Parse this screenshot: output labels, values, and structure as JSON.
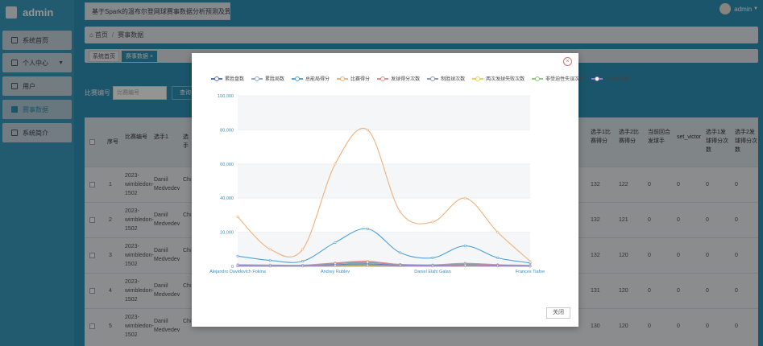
{
  "brand": {
    "name": "admin"
  },
  "user": {
    "name": "admin"
  },
  "header": {
    "title": "基于Spark的温布尔登网球赛事数据分析预测及算法实现"
  },
  "sidebar": {
    "items": [
      {
        "label": "系统首页",
        "icon": "home-icon"
      },
      {
        "label": "个人中心",
        "icon": "user-icon"
      },
      {
        "label": "用户",
        "icon": "grid-icon"
      },
      {
        "label": "赛事数据",
        "icon": "grid-icon"
      },
      {
        "label": "系统简介",
        "icon": "book-icon"
      }
    ]
  },
  "breadcrumb": {
    "home": "首页",
    "current": "赛事数据"
  },
  "tags": [
    {
      "label": "系统首页"
    },
    {
      "label": "赛事数据 ×"
    }
  ],
  "search": {
    "label": "比赛编号",
    "placeholder": "比赛编号",
    "button": "查询"
  },
  "table": {
    "headers": [
      "序号",
      "比赛编号",
      "选手1",
      "选手",
      "选手1比赛得分",
      "选手2比赛得分",
      "当前回合发球手",
      "set_victor",
      "选手1发球得分次数",
      "选手2发球得分次数"
    ],
    "rows": [
      {
        "index": "1",
        "match_id": "2023-wimbledon-1502",
        "player1": "Daniil Medvedev",
        "p2": "Chris",
        "p1_score": "132",
        "p2_score": "122",
        "server": "0",
        "victor": "0",
        "p1_serve": "0",
        "p2_serve": "0"
      },
      {
        "index": "2",
        "match_id": "2023-wimbledon-1502",
        "player1": "Daniil Medvedev",
        "p2": "Chris",
        "p1_score": "132",
        "p2_score": "121",
        "server": "0",
        "victor": "0",
        "p1_serve": "0",
        "p2_serve": "0"
      },
      {
        "index": "3",
        "match_id": "2023-wimbledon-1502",
        "player1": "Daniil Medvedev",
        "p2": "Chris",
        "p1_score": "132",
        "p2_score": "120",
        "server": "0",
        "victor": "0",
        "p1_serve": "0",
        "p2_serve": "0"
      },
      {
        "index": "4",
        "match_id": "2023-wimbledon-1502",
        "player1": "Daniil Medvedev",
        "p2": "Chris",
        "p1_score": "131",
        "p2_score": "120",
        "server": "0",
        "victor": "0",
        "p1_serve": "0",
        "p2_serve": "0"
      },
      {
        "index": "5",
        "match_id": "2023-wimbledon-1502",
        "player1": "Daniil Medvedev",
        "p2": "Chris",
        "p1_score": "130",
        "p2_score": "120",
        "server": "0",
        "victor": "0",
        "p1_serve": "0",
        "p2_serve": "0"
      }
    ]
  },
  "modal": {
    "close_label": "关闭"
  },
  "colors": {
    "accent": "#2f93b8"
  },
  "chart_data": {
    "type": "line",
    "categories": [
      "Alejandro Davidovich Fokina",
      "",
      "",
      "Andrey Rublev",
      "",
      "",
      "Daniel Elahi Galan",
      "",
      "",
      "Frances Tiafoe"
    ],
    "category_labels": [
      "Alejandro Davidovich Fokina",
      "Andrey Rublev",
      "Daniel Elahi Galan",
      "Frances Tiafoe"
    ],
    "ylim": [
      0,
      100000
    ],
    "yticks": [
      "0",
      "20,000",
      "40,000",
      "60,000",
      "80,000",
      "100,000"
    ],
    "grid": true,
    "legend_position": "top",
    "series": [
      {
        "name": "累胜盘数",
        "color": "#5470c6",
        "values": [
          300,
          200,
          200,
          1000,
          1500,
          500,
          300,
          900,
          400,
          200
        ]
      },
      {
        "name": "累胜局数",
        "color": "#91a7c7",
        "values": [
          1000,
          800,
          700,
          2000,
          2500,
          1200,
          900,
          1800,
          1000,
          600
        ]
      },
      {
        "name": "总能局得分",
        "color": "#4fa3d8",
        "values": [
          6000,
          3500,
          3000,
          14000,
          22000,
          8000,
          5000,
          12000,
          5000,
          2000
        ]
      },
      {
        "name": "比赛得分",
        "color": "#f3b07a",
        "values": [
          29000,
          10000,
          10000,
          60000,
          80000,
          32000,
          26000,
          40000,
          20000,
          3000
        ]
      },
      {
        "name": "发球得分次数",
        "color": "#e58b8b",
        "values": [
          500,
          300,
          300,
          2000,
          3000,
          1000,
          600,
          1600,
          800,
          300
        ]
      },
      {
        "name": "制胜球次数",
        "color": "#8a9bb0",
        "values": [
          400,
          300,
          300,
          1500,
          2200,
          800,
          500,
          1200,
          600,
          200
        ]
      },
      {
        "name": "两次发球失败次数",
        "color": "#e8d35a",
        "values": [
          100,
          80,
          80,
          300,
          400,
          200,
          100,
          250,
          120,
          60
        ]
      },
      {
        "name": "非受迫性失误次数",
        "color": "#8fc97a",
        "values": [
          300,
          200,
          200,
          700,
          900,
          400,
          300,
          600,
          300,
          100
        ]
      },
      {
        "name": "上网球次数",
        "color": "#9a7fc4",
        "values": [
          200,
          150,
          150,
          500,
          700,
          300,
          200,
          450,
          250,
          100
        ]
      }
    ]
  }
}
